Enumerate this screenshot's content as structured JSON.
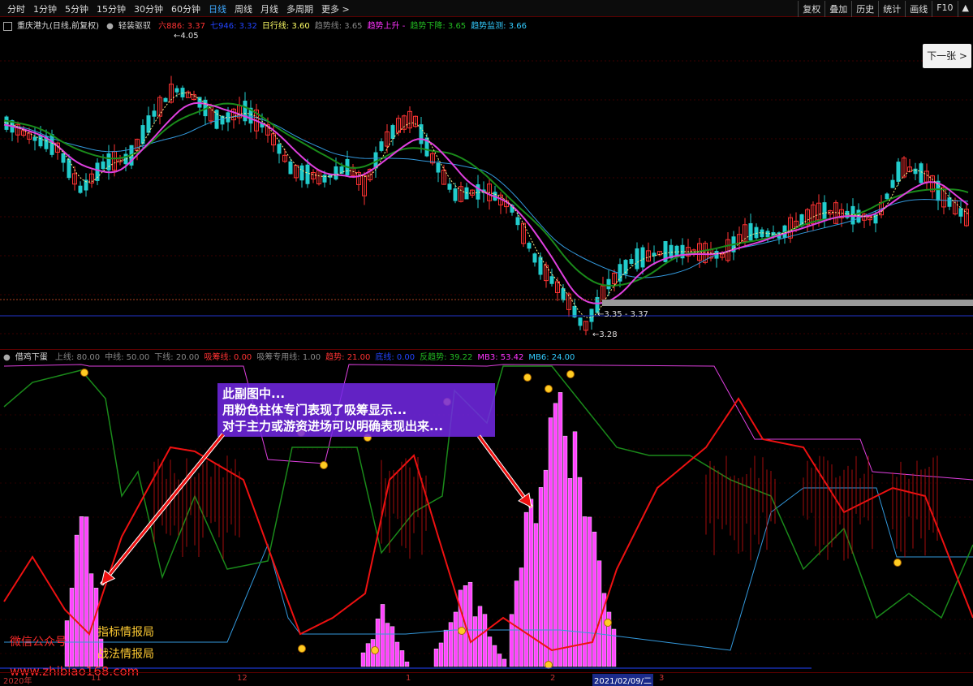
{
  "toolbar": {
    "tabs": [
      "分时",
      "1分钟",
      "5分钟",
      "15分钟",
      "30分钟",
      "60分钟",
      "日线",
      "周线",
      "月线",
      "多周期",
      "更多 >"
    ],
    "active_index": 6,
    "right_buttons": [
      "复权",
      "叠加",
      "历史",
      "统计",
      "画线",
      "F10",
      "▲"
    ]
  },
  "main": {
    "stock": "重庆港九(日线,前复权)",
    "indicator": "轻装驱驭",
    "legend": [
      {
        "text": "六886: 3.37",
        "color": "#ff3333"
      },
      {
        "text": "七946: 3.32",
        "color": "#2244ff"
      },
      {
        "text": "日行线: 3.60",
        "color": "#ffff66"
      },
      {
        "text": "趋势线: 3.65",
        "color": "#888888"
      },
      {
        "text": "趋势上升 -",
        "color": "#ff33ff"
      },
      {
        "text": "趋势下降: 3.65",
        "color": "#22bb22"
      },
      {
        "text": "趋势监测: 3.66",
        "color": "#33ccff"
      }
    ],
    "high_label": "4.05",
    "support_label": "3.35 - 3.37",
    "low_label": "3.28",
    "next_button": "下一张 >"
  },
  "sub": {
    "name": "借鸡下蛋",
    "legend": [
      {
        "text": "上线: 80.00",
        "color": "#888888"
      },
      {
        "text": "中线: 50.00",
        "color": "#888888"
      },
      {
        "text": "下线: 20.00",
        "color": "#888888"
      },
      {
        "text": "吸筹线: 0.00",
        "color": "#ff3333"
      },
      {
        "text": "吸筹专用线: 1.00",
        "color": "#888888"
      },
      {
        "text": "趋势: 21.00",
        "color": "#ff3333"
      },
      {
        "text": "底线: 0.00",
        "color": "#2244ff"
      },
      {
        "text": "反趋势: 39.22",
        "color": "#22bb22"
      },
      {
        "text": "MB3: 53.42",
        "color": "#ff33ff"
      },
      {
        "text": "MB6: 24.00",
        "color": "#33ccff"
      }
    ]
  },
  "annotation": {
    "lines": [
      "此副图中...",
      "用粉色柱体专门表现了吸筹显示...",
      "对于主力或游资进场可以明确表现出来..."
    ]
  },
  "watermark": {
    "wechat": "微信公众号",
    "name1": "指标情报局",
    "name2": "战法情报局",
    "url": "www.zhibiao168.com"
  },
  "xaxis": {
    "labels": [
      "2020年",
      "11",
      "12",
      "1",
      "2",
      "2021/02/09/二",
      "3"
    ]
  },
  "colors": {
    "up": "#ff3333",
    "down": "#22cccc",
    "pink": "#ff44ff",
    "magenta": "#e040e0",
    "green": "#1a8a1a",
    "blue": "#3399dd",
    "red": "#ee1111",
    "gold": "#ffcc22"
  }
}
